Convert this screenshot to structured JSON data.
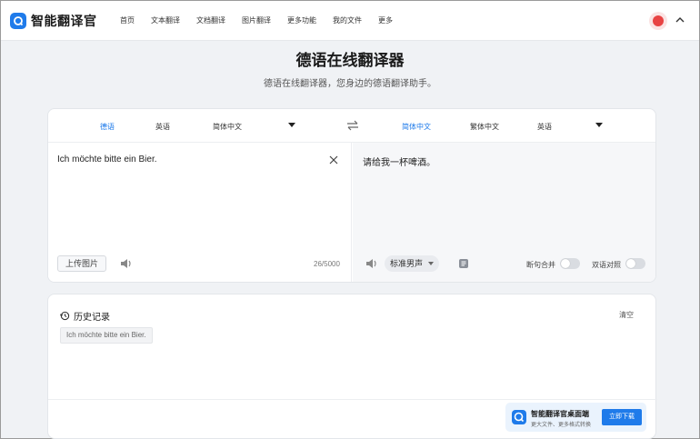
{
  "header": {
    "brand": "智能翻译官",
    "nav": [
      "首页",
      "文本翻译",
      "文档翻译",
      "图片翻译",
      "更多功能",
      "我的文件",
      "更多"
    ]
  },
  "hero": {
    "title": "德语在线翻译器",
    "subtitle": "德语在线翻译器，您身边的德语翻译助手。"
  },
  "translator": {
    "source_langs": [
      "德语",
      "英语",
      "简体中文"
    ],
    "target_langs": [
      "简体中文",
      "繁体中文",
      "英语"
    ],
    "source_text": "Ich möchte bitte ein Bier.",
    "upload_label": "上传图片",
    "char_count": "26/5000",
    "target_text": "请给我一杯啤酒。",
    "voice": "标准男声",
    "merge_label": "断句合并",
    "bilingual_label": "双语对照",
    "merge_on": false,
    "bilingual_on": false
  },
  "history": {
    "title": "历史记录",
    "clear_label": "清空",
    "items": [
      "Ich möchte bitte ein Bier."
    ]
  },
  "banner": {
    "title": "智能翻译官桌面端",
    "subtitle": "更大文件、更多格式转换",
    "button": "立即下载"
  },
  "colors": {
    "accent": "#1f7bea",
    "page_bg": "#f0f2f5",
    "target_bg": "#f6f7f9"
  }
}
